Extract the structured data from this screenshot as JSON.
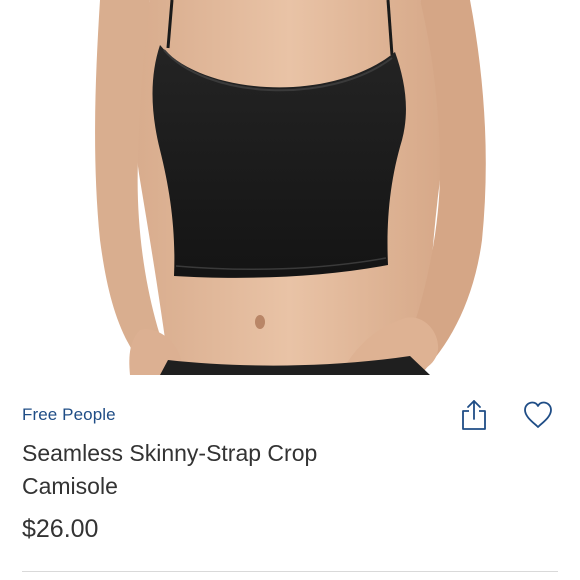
{
  "product": {
    "brand": "Free People",
    "title": "Seamless Skinny-Strap Crop Camisole",
    "price": "$26.00"
  },
  "icons": {
    "share": "share-icon",
    "like": "heart-icon"
  },
  "colors": {
    "brand_link": "#1f4d86",
    "text": "#333333",
    "icon": "#1f4d86",
    "garment": "#1c1c1c"
  }
}
